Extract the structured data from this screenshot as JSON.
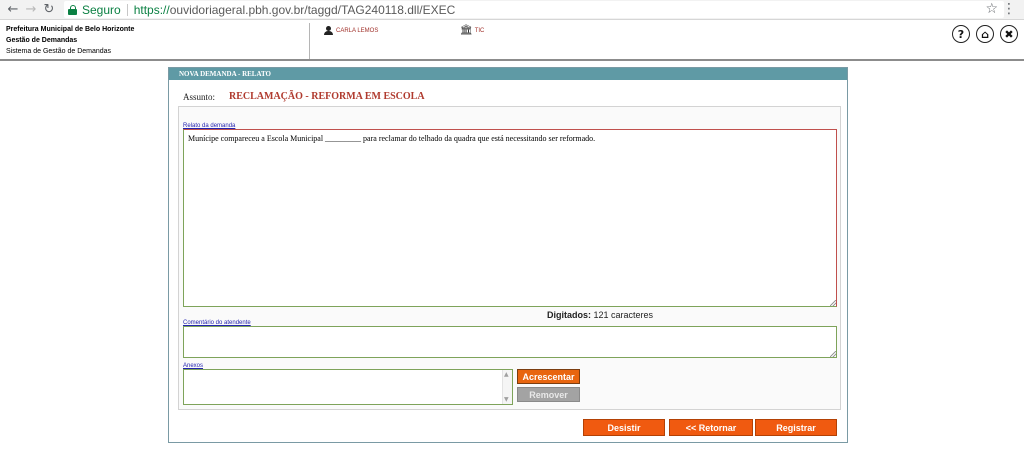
{
  "browser": {
    "back_icon": "←",
    "forward_icon": "→",
    "reload_icon": "↻",
    "secure_label": "Seguro",
    "url_scheme": "https://",
    "url_rest": "ouvidoriageral.pbh.gov.br/taggd/TAG240118.dll/EXEC",
    "star_icon": "☆",
    "menu_icon": "⋮"
  },
  "header": {
    "org_name": "Prefeitura Municipal de Belo Horizonte",
    "module": "Gestão de Demandas",
    "system": "Sistema de Gestão de Demandas",
    "user_name": "CARLA LEMOS",
    "unit_name": "TIC",
    "help_label": "?",
    "home_label": "⌂",
    "close_label": "✖"
  },
  "panel": {
    "title": "NOVA DEMANDA - RELATO",
    "subject_label": "Assunto:",
    "subject_value": "RECLAMAÇÃO - REFORMA EM ESCOLA",
    "relato_label": "Relato da demanda",
    "relato_text": "Munícipe compareceu a  Escola Municipal _________  para reclamar do telhado da quadra que está necessitando ser reformado.",
    "typed_label": "Digitados:",
    "typed_count": "121 caracteres",
    "comment_label": "Comentário do atendente",
    "comment_value": "",
    "attachments_label": "Anexos",
    "add_button": "Acrescentar",
    "remove_button": "Remover",
    "scroll_up": "▲",
    "scroll_down": "▼"
  },
  "actions": {
    "desistir": "Desistir",
    "retornar": "<< Retornar",
    "registrar": "Registrar"
  },
  "colors": {
    "panel_title_bg": "#5f9aa5",
    "subject_color": "#b03a2e",
    "button_orange": "#f05a10",
    "secure_green": "#0b8043"
  }
}
